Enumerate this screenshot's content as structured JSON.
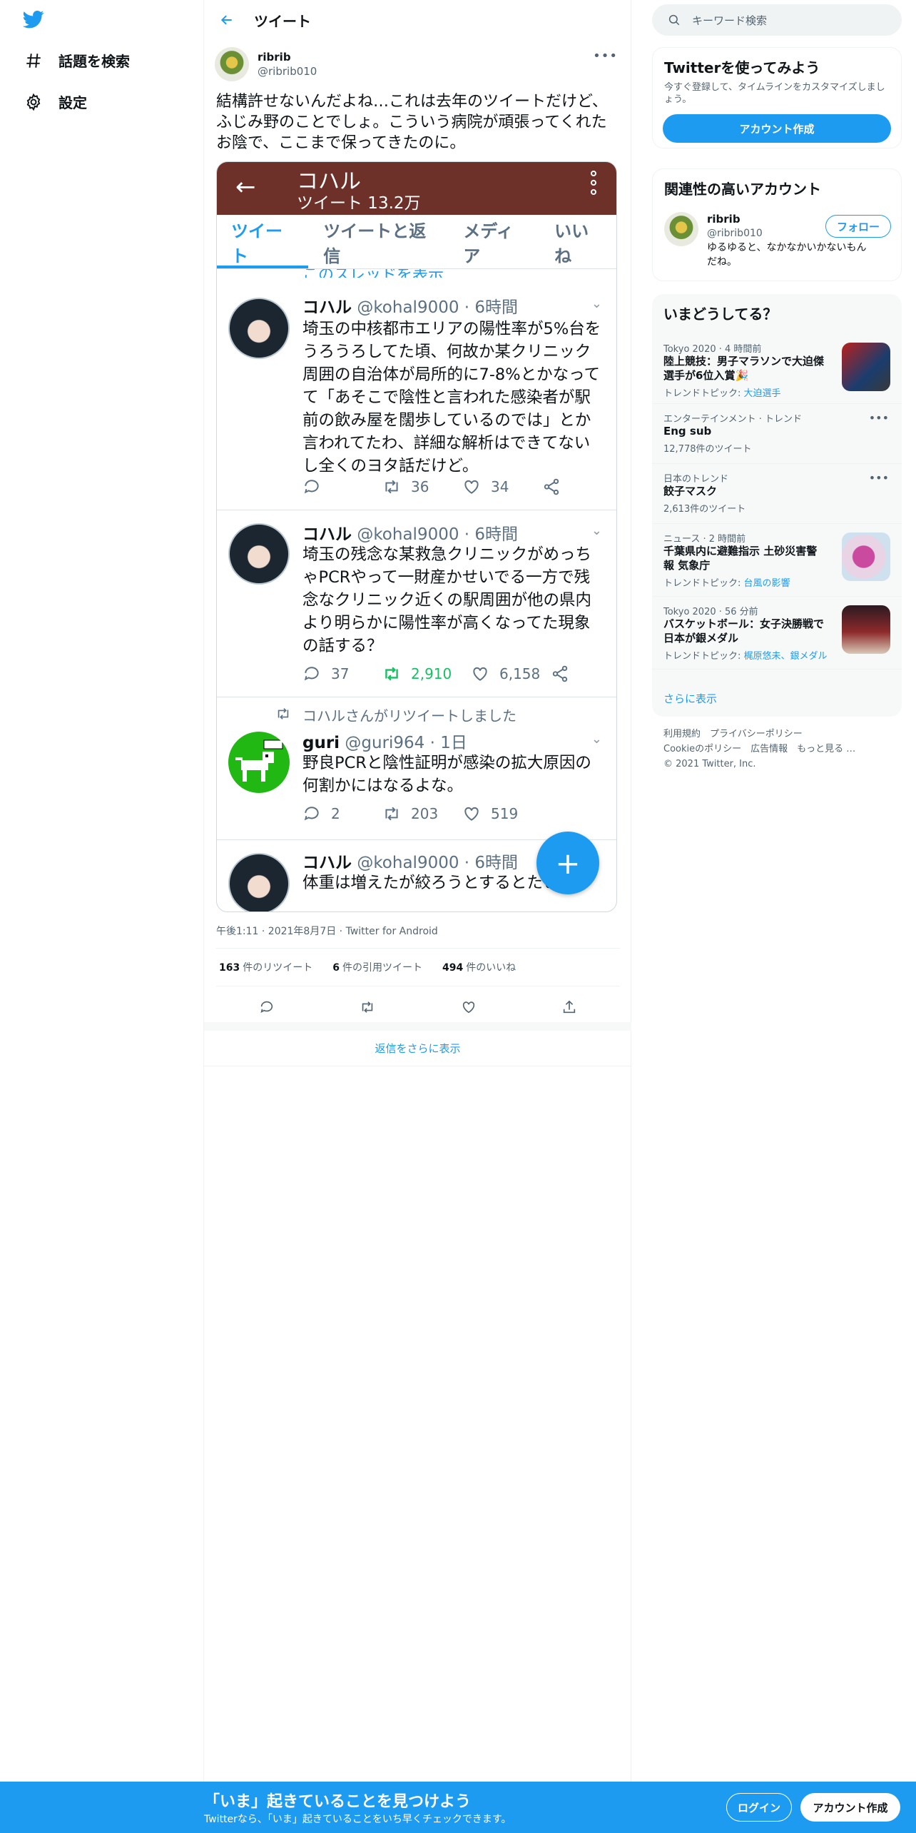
{
  "nav": {
    "explore_label": "話題を検索",
    "settings_label": "設定"
  },
  "header": {
    "title": "ツイート"
  },
  "tweet": {
    "author_name": "ribrib",
    "author_handle": "@ribrib010",
    "text": "結構許せないんだよね…これは去年のツイートだけど、ふじみ野のことでしょ。こういう病院が頑張ってくれたお陰で、ここまで保ってきたのに。",
    "timestamp": "午後1:11 · 2021年8月7日 · Twitter for Android",
    "retweets_count": "163",
    "retweets_label": "件のリツイート",
    "quotes_count": "6",
    "quotes_label": "件の引用ツイート",
    "likes_count": "494",
    "likes_label": "件のいいね"
  },
  "embedded": {
    "profile_name": "コハル",
    "tweet_count": "ツイート 13.2万",
    "tabs": [
      "ツイート",
      "ツイートと返信",
      "メディア",
      "いいね"
    ],
    "cut_text": "このスレッドを表示",
    "tweets": [
      {
        "name": "コハル",
        "meta": "@kohal9000 · 6時間",
        "text": "埼玉の中核都市エリアの陽性率が5%台をうろうろしてた頃、何故か某クリニック周囲の自治体が局所的に7-8%とかなってて「あそこで陰性と言われた感染者が駅前の飲み屋を闊歩しているのでは」とか言われてたわ、詳細な解析はできてないし全くのヨタ話だけど。",
        "replies": "",
        "retweets": "36",
        "likes": "34"
      },
      {
        "name": "コハル",
        "meta": "@kohal9000 · 6時間",
        "text": "埼玉の残念な某救急クリニックがめっちゃPCRやって一財産かせいでる一方で残念なクリニック近くの駅周囲が他の県内より明らかに陽性率が高くなってた現象の話する？",
        "replies": "37",
        "retweets": "2,910",
        "likes": "6,158"
      },
      {
        "rt_note": "コハルさんがリツイートしました",
        "name": "guri",
        "meta": "@guri964 · 1日",
        "text": "野良PCRと陰性証明が感染の拡大原因の何割かにはなるよな。",
        "replies": "2",
        "retweets": "203",
        "likes": "519"
      },
      {
        "name": "コハル",
        "meta": "@kohal9000 · 6時間",
        "text": "体重は増えたが絞ろうとするとたいてい"
      }
    ]
  },
  "show_more_replies": "返信をさらに表示",
  "sidebar": {
    "search_placeholder": "キーワード検索",
    "signup_card": {
      "title": "Twitterを使ってみよう",
      "subtitle": "今すぐ登録して、タイムラインをカスタマイズしましょう。",
      "button": "アカウント作成"
    },
    "related": {
      "title": "関連性の高いアカウント",
      "name": "ribrib",
      "handle": "@ribrib010",
      "bio": "ゆるゆると、なかなかいかないもんだね。",
      "follow": "フォロー"
    },
    "trends": {
      "title": "いまどうしてる？",
      "items": [
        {
          "context": "Tokyo 2020 · 4 時間前",
          "title": "陸上競技：男子マラソンで大迫傑選手が6位入賞🎉",
          "sub_prefix": "トレンドトピック: ",
          "sub_link": "大迫選手"
        },
        {
          "context": "エンターテインメント · トレンド",
          "title": "Eng sub",
          "sub": "12,778件のツイート"
        },
        {
          "context": "日本のトレンド",
          "title": "餃子マスク",
          "sub": "2,613件のツイート"
        },
        {
          "context": "ニュース · 2 時間前",
          "title": "千葉県内に避難指示 土砂災害警報 気象庁",
          "sub_prefix": "トレンドトピック: ",
          "sub_link": "台風の影響"
        },
        {
          "context": "Tokyo 2020 · 56 分前",
          "title": "バスケットボール：女子決勝戦で日本が銀メダル",
          "sub_prefix": "トレンドトピック: ",
          "sub_link": "梶原悠未、銀メダル"
        }
      ],
      "show_more": "さらに表示"
    },
    "footer": {
      "line1": "利用規約　プライバシーポリシー",
      "line2": "Cookieのポリシー　広告情報　もっと見る …",
      "line3": "© 2021 Twitter, Inc."
    }
  },
  "banner": {
    "headline": "「いま」起きていることを見つけよう",
    "sub": "Twitterなら、「いま」起きていることをいち早くチェックできます。",
    "login": "ログイン",
    "signup": "アカウント作成"
  },
  "colors": {
    "brand": "#1d9bf0",
    "embedded_header": "#6d3129",
    "retweet_green": "#17bf63"
  }
}
